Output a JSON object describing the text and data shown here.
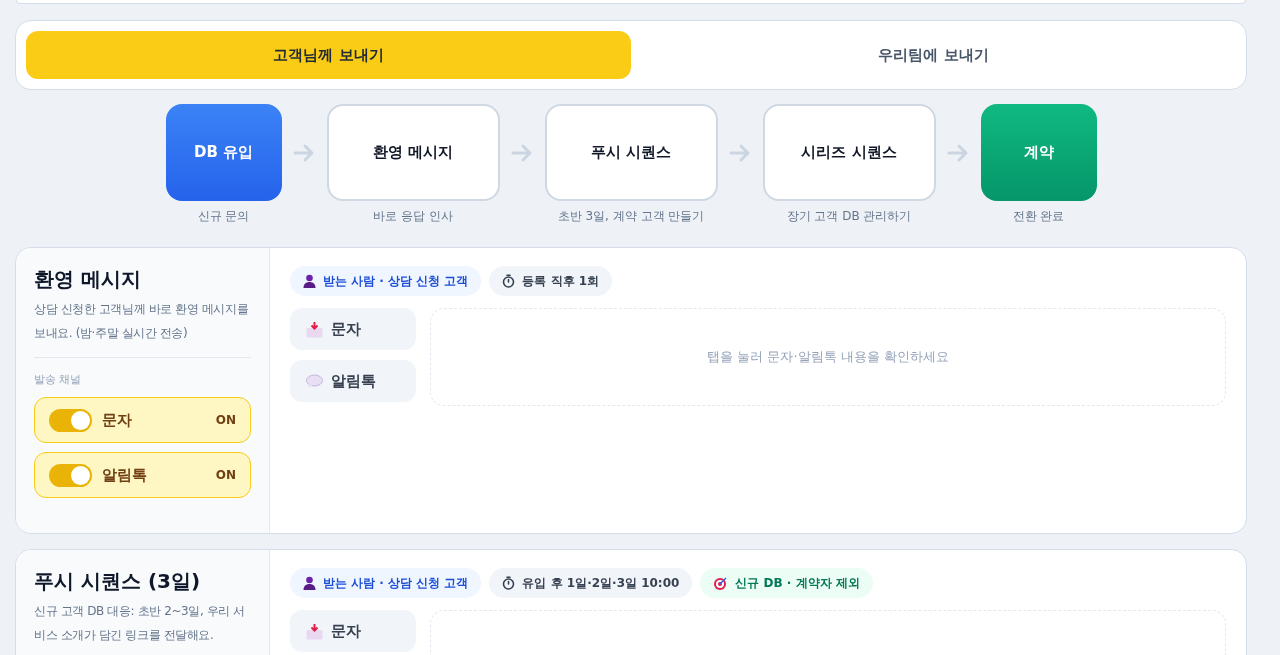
{
  "send_tabs": [
    {
      "label": "고객님께 보내기",
      "selected": true
    },
    {
      "label": "우리팀에 보내기",
      "selected": false
    }
  ],
  "flow": [
    {
      "kind": "start",
      "label": "DB 유입",
      "caption": "신규 문의"
    },
    {
      "kind": "step",
      "label": "환영 메시지",
      "caption": "바로 응답 인사"
    },
    {
      "kind": "step",
      "label": "푸시 시퀀스",
      "caption": "초반 3일, 계약 고객 만들기"
    },
    {
      "kind": "step",
      "label": "시리즈 시퀀스",
      "caption": "장기 고객 DB 관리하기"
    },
    {
      "kind": "end",
      "label": "계약",
      "caption": "전환 완료"
    }
  ],
  "sections": [
    {
      "title": "환영 메시지",
      "description": "상담 신청한 고객님께 바로 환영 메시지를 보내요. (밤·주말 실시간 전송)",
      "channels_label": "발송 채널",
      "channels": [
        {
          "label": "문자",
          "on": true,
          "state": "ON"
        },
        {
          "label": "알림톡",
          "on": true,
          "state": "ON"
        }
      ],
      "chips": [
        {
          "kind": "recipient",
          "text": "받는 사람 · 상담 신청 고객"
        },
        {
          "kind": "timing",
          "text": "등록 직후 1회"
        }
      ],
      "message_tabs": [
        {
          "kind": "sms",
          "label": "문자",
          "selected": false
        },
        {
          "kind": "talk",
          "label": "알림톡",
          "selected": false
        }
      ],
      "preview_hint": "탭을 눌러 문자·알림톡 내용을 확인하세요"
    },
    {
      "title": "푸시 시퀀스 (3일)",
      "description": "신규 고객 DB 대응: 초반 2~3일, 우리 서비스 소개가 담긴 링크를 전달해요.",
      "chips": [
        {
          "kind": "recipient",
          "text": "받는 사람 · 상담 신청 고객"
        },
        {
          "kind": "timing",
          "text": "유입 후 1일·2일·3일 10:00"
        },
        {
          "kind": "target",
          "text": "신규 DB · 계약자 제외"
        }
      ],
      "message_tabs": [
        {
          "kind": "sms",
          "label": "문자",
          "selected": false
        }
      ]
    }
  ]
}
